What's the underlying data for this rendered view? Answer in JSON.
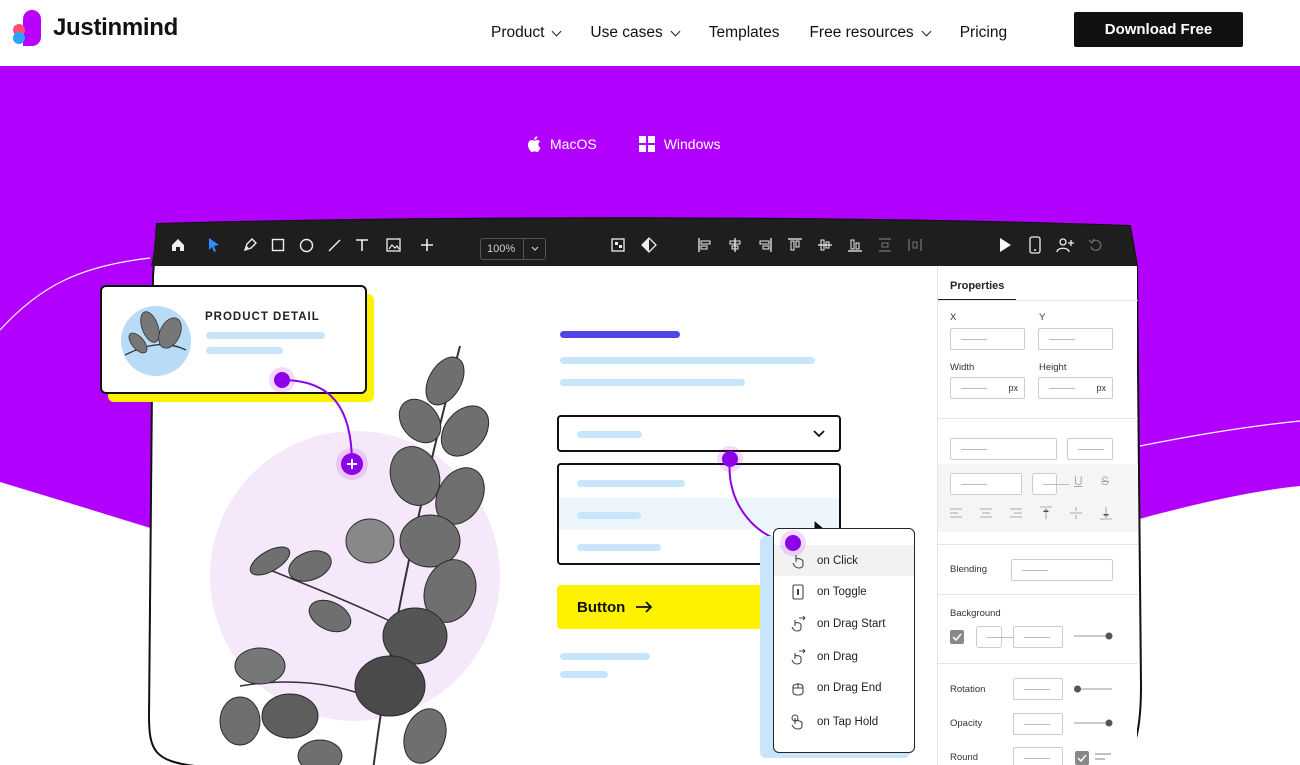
{
  "brand": {
    "name": "Justinmind"
  },
  "nav": {
    "items": [
      {
        "label": "Product",
        "has_dropdown": true
      },
      {
        "label": "Use cases",
        "has_dropdown": true
      },
      {
        "label": "Templates",
        "has_dropdown": false
      },
      {
        "label": "Free resources",
        "has_dropdown": true
      },
      {
        "label": "Pricing",
        "has_dropdown": false
      }
    ],
    "cta": "Download Free"
  },
  "os": {
    "mac": "MacOS",
    "windows": "Windows"
  },
  "editor": {
    "zoom": "100%",
    "properties": {
      "tab": "Properties",
      "x": "X",
      "y": "Y",
      "width": "Width",
      "height": "Height",
      "unit": "px",
      "blending": "Blending",
      "background": "Background",
      "rotation": "Rotation",
      "opacity": "Opacity",
      "round": "Round"
    },
    "canvas": {
      "product_detail": "PRODUCT DETAIL",
      "button_label": "Button"
    },
    "events": [
      {
        "label": "on Click",
        "icon": "tap-icon"
      },
      {
        "label": "on Toggle",
        "icon": "toggle-icon"
      },
      {
        "label": "on Drag Start",
        "icon": "drag-start-icon"
      },
      {
        "label": "on Drag",
        "icon": "drag-icon"
      },
      {
        "label": "on Drag End",
        "icon": "drag-end-icon"
      },
      {
        "label": "on Tap Hold",
        "icon": "tap-hold-icon"
      }
    ]
  },
  "colors": {
    "brand_purple": "#b200ff",
    "accent_yellow": "#fff200",
    "dark": "#111111",
    "light_blue": "#c8e6fb",
    "indigo": "#4f46e5"
  }
}
